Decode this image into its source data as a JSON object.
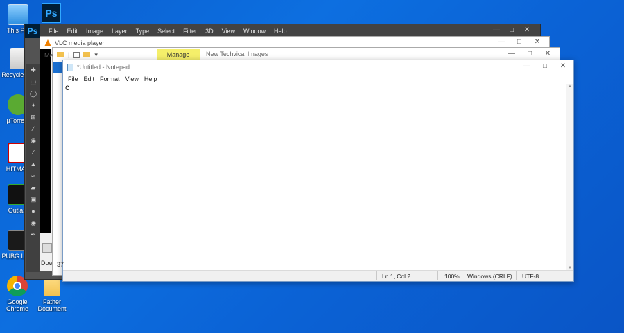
{
  "desktop": {
    "icons": [
      {
        "label": "This PC",
        "icon": "computer-icon"
      },
      {
        "label": "Recycle Bin",
        "icon": "recycle-bin-icon"
      },
      {
        "label": "µTorrent",
        "icon": "utorrent-icon"
      },
      {
        "label": "HITMAN",
        "icon": "hitman-icon"
      },
      {
        "label": "Outlast",
        "icon": "outlast-icon"
      },
      {
        "label": "PUBG LITE",
        "icon": "pubg-icon"
      },
      {
        "label": "Google Chrome",
        "icon": "chrome-icon"
      },
      {
        "label": "Father Document",
        "icon": "folder-icon"
      }
    ],
    "ps_shortcut": "Ps"
  },
  "photoshop": {
    "logo": "Ps",
    "menu": [
      "File",
      "Edit",
      "Image",
      "Layer",
      "Type",
      "Select",
      "Filter",
      "3D",
      "View",
      "Window",
      "Help"
    ]
  },
  "vlc": {
    "title": "VLC media player",
    "partial_text": [
      "37",
      "Dow"
    ]
  },
  "explorer": {
    "manage": "Manage",
    "title": "New Techvical Images",
    "partial_text": [
      "Me"
    ]
  },
  "notepad": {
    "title": "*Untitled - Notepad",
    "menu": [
      "File",
      "Edit",
      "Format",
      "View",
      "Help"
    ],
    "content": "C",
    "status": {
      "position": "Ln 1, Col 2",
      "zoom": "100%",
      "line_ending": "Windows (CRLF)",
      "encoding": "UTF-8"
    }
  }
}
